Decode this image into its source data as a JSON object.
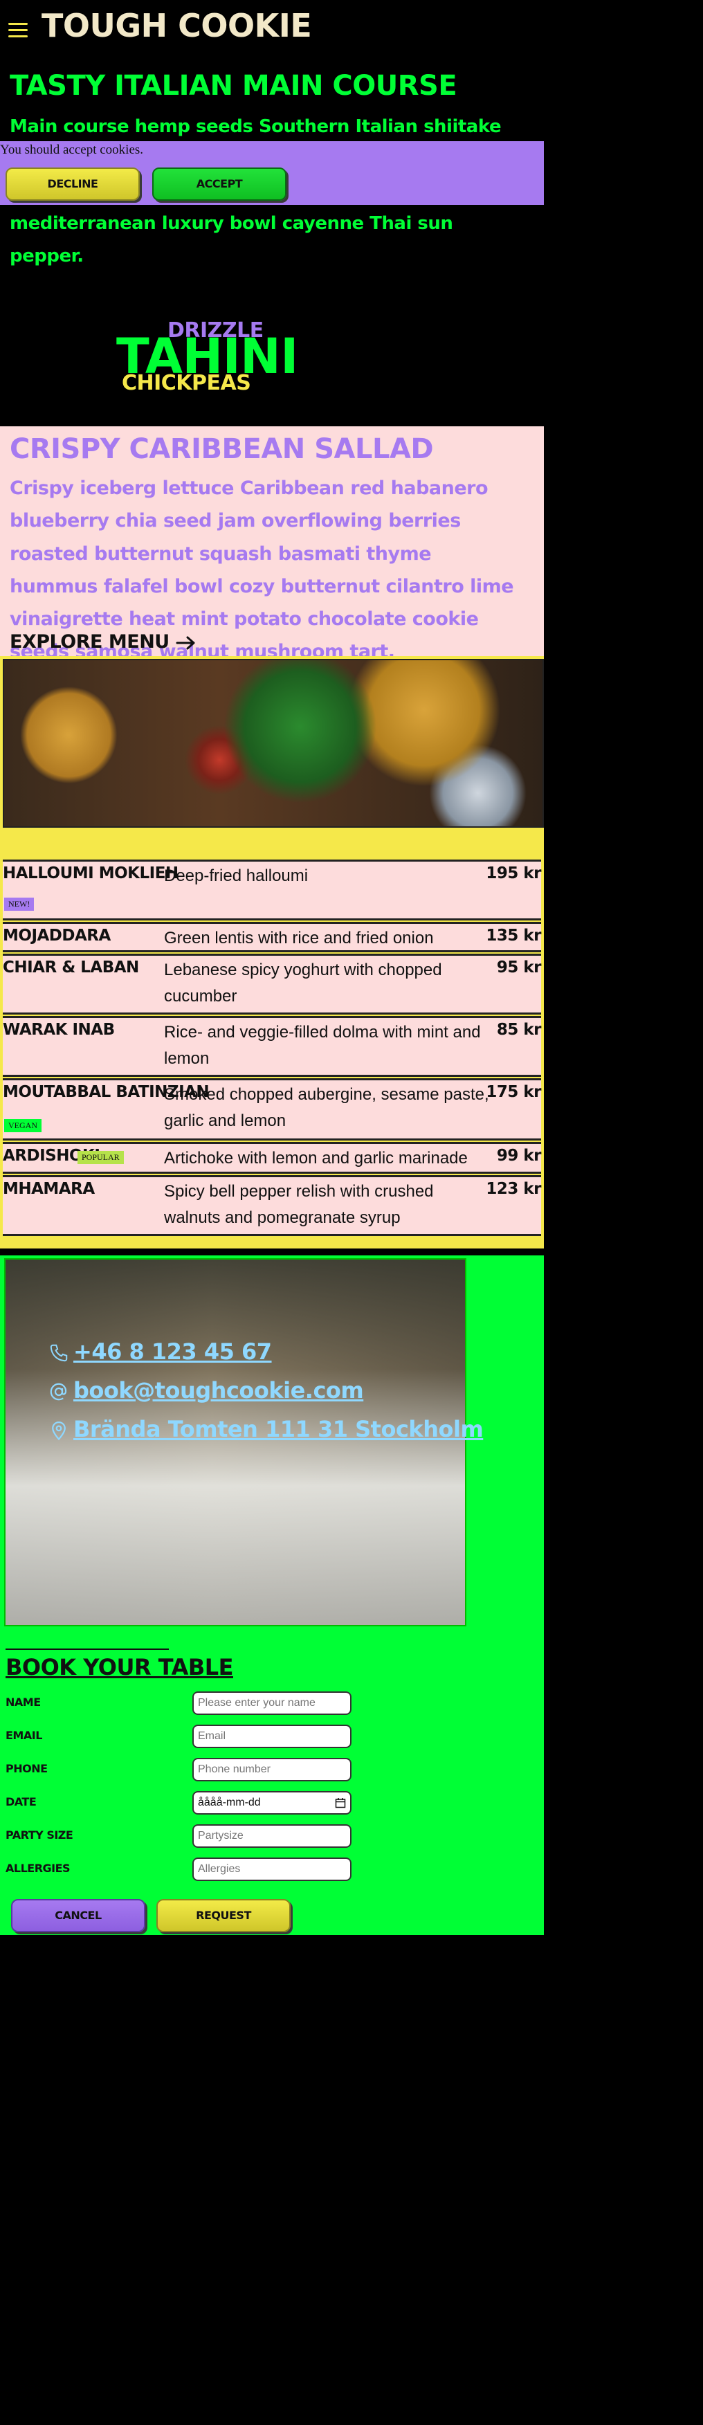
{
  "header": {
    "logo": "TOUGH COOKIE"
  },
  "hero": {
    "title": "TASTY ITALIAN MAIN COURSE",
    "text": "Main course hemp seeds Southern Italian shiitake mushrooms a Seasonal edamame hummus asian pear kale bite sized ghost pepper one bowl mediterranean luxury bowl cayenne Thai sun pepper."
  },
  "cookie_banner": {
    "text": "You should accept cookies.",
    "decline_label": "DECLINE",
    "accept_label": "ACCEPT"
  },
  "graphic": {
    "word1": "DRIZZLE",
    "word2": "TAHINI",
    "word3": "CHICKPEAS"
  },
  "crispy": {
    "title": "CRISPY CARIBBEAN SALLAD",
    "text": "Crispy iceberg lettuce Caribbean red habanero blueberry chia seed jam overflowing berries roasted butternut squash basmati thyme hummus falafel bowl cozy butternut cilantro lime vinaigrette heat mint potato chocolate cookie seeds samosa walnut mushroom tart.",
    "explore_label": "EXPLORE MENU"
  },
  "menu": {
    "items": [
      {
        "name": "HALLOUMI MOKLIEH",
        "desc": "Deep-fried halloumi",
        "price": "195 kr",
        "tag": "NEW!"
      },
      {
        "name": "MOJADDARA",
        "desc": "Green lentis with rice and fried onion",
        "price": "135 kr",
        "tag": ""
      },
      {
        "name": "CHIAR & LABAN",
        "desc": "Lebanese spicy yoghurt with chopped cucumber",
        "price": "95 kr",
        "tag": ""
      },
      {
        "name": "WARAK INAB",
        "desc": "Rice- and veggie-filled dolma with mint and lemon",
        "price": "85 kr",
        "tag": ""
      },
      {
        "name": "MOUTABBAL BATINZIAN",
        "desc": "Smoked chopped aubergine, sesame paste, garlic and lemon",
        "price": "175 kr",
        "tag": "VEGAN"
      },
      {
        "name": "ARDISHOKI",
        "desc": "Artichoke with lemon and garlic marinade",
        "price": "99 kr",
        "tag": "POPULAR"
      },
      {
        "name": "MHAMARA",
        "desc": "Spicy bell pepper relish with crushed walnuts and pomegranate syrup",
        "price": "123 kr",
        "tag": ""
      }
    ],
    "tag_colors": {
      "NEW!": "#a67af0",
      "VEGAN": "#00ff35",
      "POPULAR": "#b6e24a"
    }
  },
  "contact": {
    "phone": "+46 8 123 45 67",
    "email": "book@toughcookie.com",
    "address": "Brända Tomten 111 31 Stockholm"
  },
  "booking": {
    "title": "BOOK YOUR TABLE",
    "fields": [
      {
        "label": "NAME",
        "placeholder": "Please enter your name"
      },
      {
        "label": "EMAIL",
        "placeholder": "Email"
      },
      {
        "label": "PHONE",
        "placeholder": "Phone number"
      },
      {
        "label": "DATE",
        "placeholder": "åååå-mm-dd"
      },
      {
        "label": "PARTY SIZE",
        "placeholder": "Partysize"
      },
      {
        "label": "ALLERGIES",
        "placeholder": "Allergies"
      }
    ],
    "cancel_label": "CANCEL",
    "request_label": "REQUEST"
  },
  "colors": {
    "background": "#000000",
    "green": "#00ff35",
    "purple": "#a67af0",
    "yellow": "#f5e84a",
    "pink": "#fddcdc",
    "link_blue": "#8fd8ff"
  }
}
